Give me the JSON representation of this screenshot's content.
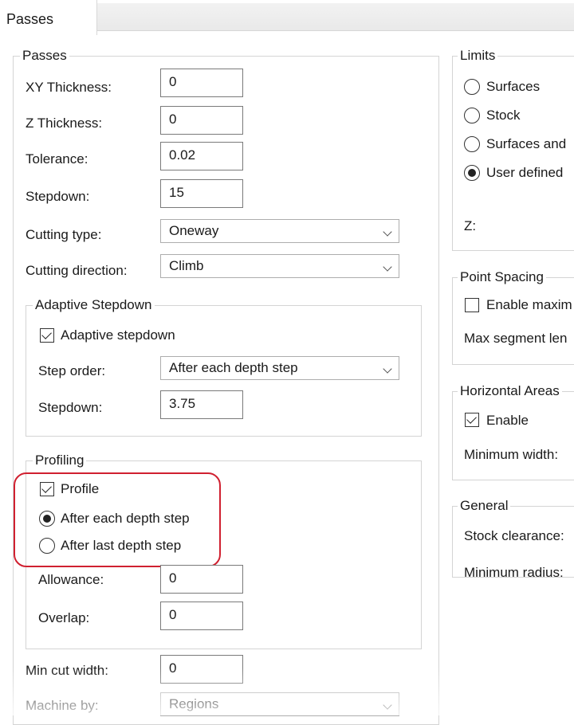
{
  "tab": {
    "label": "Passes"
  },
  "passes": {
    "title": "Passes",
    "xy_thickness": {
      "label": "XY Thickness:",
      "value": "0"
    },
    "z_thickness": {
      "label": "Z Thickness:",
      "value": "0"
    },
    "tolerance": {
      "label": "Tolerance:",
      "value": "0.02"
    },
    "stepdown": {
      "label": "Stepdown:",
      "value": "15"
    },
    "cutting_type": {
      "label": "Cutting type:",
      "value": "Oneway"
    },
    "cutting_direction": {
      "label": "Cutting direction:",
      "value": "Climb"
    },
    "min_cut_width": {
      "label": "Min cut width:",
      "value": "0"
    },
    "machine_by": {
      "label": "Machine by:",
      "value": "Regions"
    }
  },
  "adaptive": {
    "title": "Adaptive Stepdown",
    "checkbox_label": "Adaptive stepdown",
    "checked": true,
    "step_order": {
      "label": "Step order:",
      "value": "After each depth step"
    },
    "stepdown": {
      "label": "Stepdown:",
      "value": "3.75"
    }
  },
  "profiling": {
    "title": "Profiling",
    "profile_label": "Profile",
    "profile_checked": true,
    "option_each": "After each depth step",
    "option_last": "After last depth step",
    "selected": "After each depth step",
    "allowance": {
      "label": "Allowance:",
      "value": "0"
    },
    "overlap": {
      "label": "Overlap:",
      "value": "0"
    }
  },
  "limits": {
    "title": "Limits",
    "options": [
      "Surfaces",
      "Stock",
      "Surfaces and",
      "User defined"
    ],
    "selected": "User defined",
    "z_label": "Z:"
  },
  "point_spacing": {
    "title": "Point Spacing",
    "enable_label": "Enable maxim",
    "enable_checked": false,
    "max_segment_label": "Max segment len"
  },
  "horizontal_areas": {
    "title": "Horizontal Areas",
    "enable_label": "Enable",
    "enable_checked": true,
    "min_width_label": "Minimum width:"
  },
  "general": {
    "title": "General",
    "stock_clearance_label": "Stock clearance:",
    "min_radius_label": "Minimum radius:"
  },
  "colors": {
    "highlight": "#d02030"
  }
}
